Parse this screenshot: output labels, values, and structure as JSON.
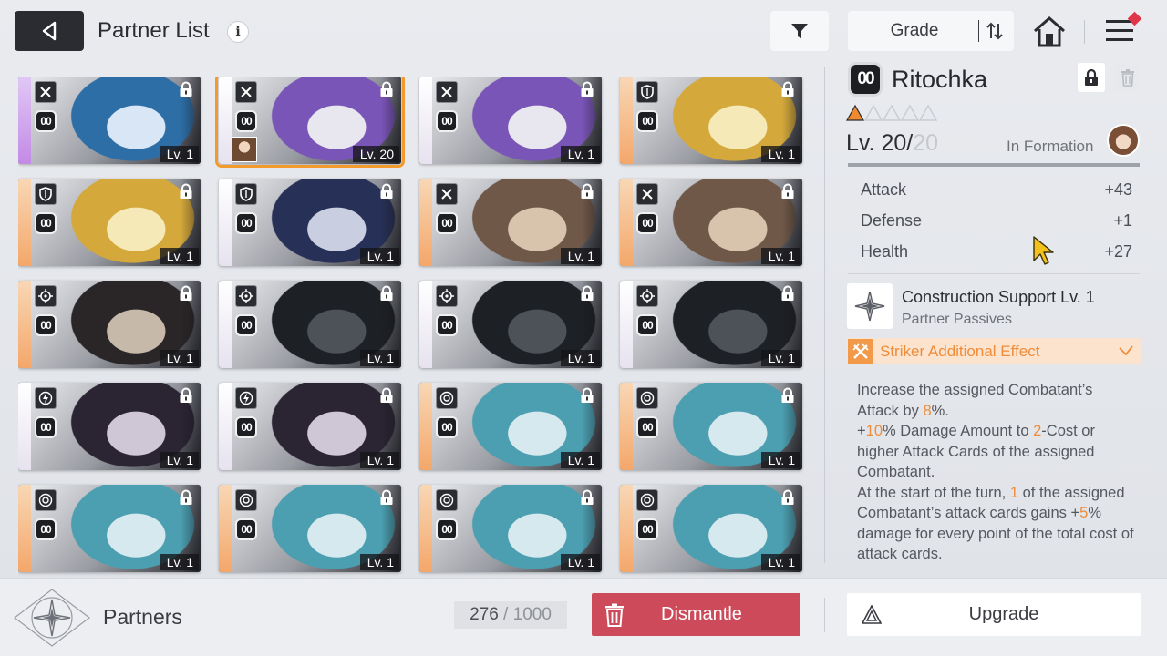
{
  "header": {
    "title": "Partner List",
    "info_icon": "info-icon",
    "filter_icon": "filter-icon",
    "sort_label": "Grade",
    "sort_order_icon": "sort-order-icon",
    "home_icon": "home-icon",
    "menu_icon": "hamburger-menu-icon",
    "notification_color": "#e0344a"
  },
  "cards": [
    {
      "portrait": "blue-hair-girl",
      "class": "striker",
      "cost": "00",
      "level": "Lv. 1",
      "rarity": "purple",
      "selected": false,
      "in_formation": false,
      "colors": [
        "#d9e6f5",
        "#2e6ea6"
      ]
    },
    {
      "portrait": "purple-hair-winter-girl",
      "class": "striker",
      "cost": "00",
      "level": "Lv. 20",
      "rarity": "white",
      "selected": true,
      "in_formation": true,
      "colors": [
        "#e8e6ee",
        "#7a55b8"
      ]
    },
    {
      "portrait": "purple-hair-winter-girl",
      "class": "striker",
      "cost": "00",
      "level": "Lv. 1",
      "rarity": "white",
      "selected": false,
      "in_formation": false,
      "colors": [
        "#e8e6ee",
        "#7a55b8"
      ]
    },
    {
      "portrait": "blonde-headset-girl",
      "class": "vanguard",
      "cost": "00",
      "level": "Lv. 1",
      "rarity": "orange",
      "selected": false,
      "in_formation": false,
      "colors": [
        "#f5e9b8",
        "#d4a83a"
      ]
    },
    {
      "portrait": "blonde-headset-girl",
      "class": "vanguard",
      "cost": "00",
      "level": "Lv. 1",
      "rarity": "orange",
      "selected": false,
      "in_formation": false,
      "colors": [
        "#f5e9b8",
        "#d4a83a"
      ]
    },
    {
      "portrait": "navy-hair-girl",
      "class": "vanguard",
      "cost": "00",
      "level": "Lv. 1",
      "rarity": "white",
      "selected": false,
      "in_formation": false,
      "colors": [
        "#c9cfe0",
        "#273056"
      ]
    },
    {
      "portrait": "brown-hair-flower-girl",
      "class": "striker",
      "cost": "00",
      "level": "Lv. 1",
      "rarity": "orange",
      "selected": false,
      "in_formation": false,
      "colors": [
        "#d8c3ad",
        "#6f5848"
      ]
    },
    {
      "portrait": "brown-hair-flower-girl",
      "class": "striker",
      "cost": "00",
      "level": "Lv. 1",
      "rarity": "orange",
      "selected": false,
      "in_formation": false,
      "colors": [
        "#d8c3ad",
        "#6f5848"
      ]
    },
    {
      "portrait": "black-bunny-creature",
      "class": "ranger",
      "cost": "00",
      "level": "Lv. 1",
      "rarity": "orange",
      "selected": false,
      "in_formation": false,
      "colors": [
        "#c6b9a9",
        "#2a2628"
      ]
    },
    {
      "portrait": "mecha-arm",
      "class": "ranger",
      "cost": "00",
      "level": "Lv. 1",
      "rarity": "white",
      "selected": false,
      "in_formation": false,
      "colors": [
        "#4d5259",
        "#1d2024"
      ]
    },
    {
      "portrait": "mecha-arm",
      "class": "ranger",
      "cost": "00",
      "level": "Lv. 1",
      "rarity": "white",
      "selected": false,
      "in_formation": false,
      "colors": [
        "#4d5259",
        "#1d2024"
      ]
    },
    {
      "portrait": "mecha-arm",
      "class": "ranger",
      "cost": "00",
      "level": "Lv. 1",
      "rarity": "white",
      "selected": false,
      "in_formation": false,
      "colors": [
        "#4d5259",
        "#1d2024"
      ]
    },
    {
      "portrait": "glasses-dark-hair-girl",
      "class": "controller",
      "cost": "00",
      "level": "Lv. 1",
      "rarity": "white",
      "selected": false,
      "in_formation": false,
      "colors": [
        "#cfc6d6",
        "#2b2433"
      ]
    },
    {
      "portrait": "glasses-dark-hair-girl",
      "class": "controller",
      "cost": "00",
      "level": "Lv. 1",
      "rarity": "white",
      "selected": false,
      "in_formation": false,
      "colors": [
        "#cfc6d6",
        "#2b2433"
      ]
    },
    {
      "portrait": "teal-hair-winking-girl",
      "class": "psionic",
      "cost": "00",
      "level": "Lv. 1",
      "rarity": "orange",
      "selected": false,
      "in_formation": false,
      "colors": [
        "#d6e9ee",
        "#4b9fb0"
      ]
    },
    {
      "portrait": "teal-hair-winking-girl",
      "class": "psionic",
      "cost": "00",
      "level": "Lv. 1",
      "rarity": "orange",
      "selected": false,
      "in_formation": false,
      "colors": [
        "#d6e9ee",
        "#4b9fb0"
      ]
    },
    {
      "portrait": "teal-hair-winking-girl",
      "class": "psionic",
      "cost": "00",
      "level": "Lv. 1",
      "rarity": "orange",
      "selected": false,
      "in_formation": false,
      "colors": [
        "#d6e9ee",
        "#4b9fb0"
      ]
    },
    {
      "portrait": "teal-hair-winking-girl",
      "class": "psionic",
      "cost": "00",
      "level": "Lv. 1",
      "rarity": "orange",
      "selected": false,
      "in_formation": false,
      "colors": [
        "#d6e9ee",
        "#4b9fb0"
      ]
    },
    {
      "portrait": "teal-hair-winking-girl",
      "class": "psionic",
      "cost": "00",
      "level": "Lv. 1",
      "rarity": "orange",
      "selected": false,
      "in_formation": false,
      "colors": [
        "#d6e9ee",
        "#4b9fb0"
      ]
    },
    {
      "portrait": "teal-hair-winking-girl",
      "class": "psionic",
      "cost": "00",
      "level": "Lv. 1",
      "rarity": "orange",
      "selected": false,
      "in_formation": false,
      "colors": [
        "#d6e9ee",
        "#4b9fb0"
      ]
    }
  ],
  "detail": {
    "cost": "00",
    "name": "Ritochka",
    "stars_filled": 1,
    "stars_total": 5,
    "level_current": "Lv. 20/",
    "level_max": "20",
    "level_progress": 1.0,
    "in_formation_label": "In Formation",
    "stats": [
      {
        "label": "Attack",
        "value": "+43"
      },
      {
        "label": "Defense",
        "value": "+1"
      },
      {
        "label": "Health",
        "value": "+27"
      }
    ],
    "passive_name": "Construction Support Lv. 1",
    "passive_type": "Partner Passives",
    "effect_label": "Striker Additional Effect",
    "description": {
      "p1": "Increase the assigned Combatant’s Attack by ",
      "v1": "8",
      "p2": "%.",
      "p3": "+",
      "v2": "10",
      "p4": "% Damage Amount to ",
      "v3": "2",
      "p5": "-Cost or higher Attack Cards of the assigned Combatant.",
      "p6": "At the start of the turn, ",
      "v4": "1",
      "p7": " of the assigned Combatant’s attack cards gains +",
      "v5": "5",
      "p8": "% damage for every point of the total cost of attack cards."
    },
    "accent_color": "#ef8c3a"
  },
  "footer": {
    "title": "Partners",
    "count_current": "276",
    "count_sep": " / ",
    "count_max": "1000",
    "dismantle_label": "Dismantle",
    "upgrade_label": "Upgrade",
    "dismantle_color": "#cc4a5a"
  }
}
